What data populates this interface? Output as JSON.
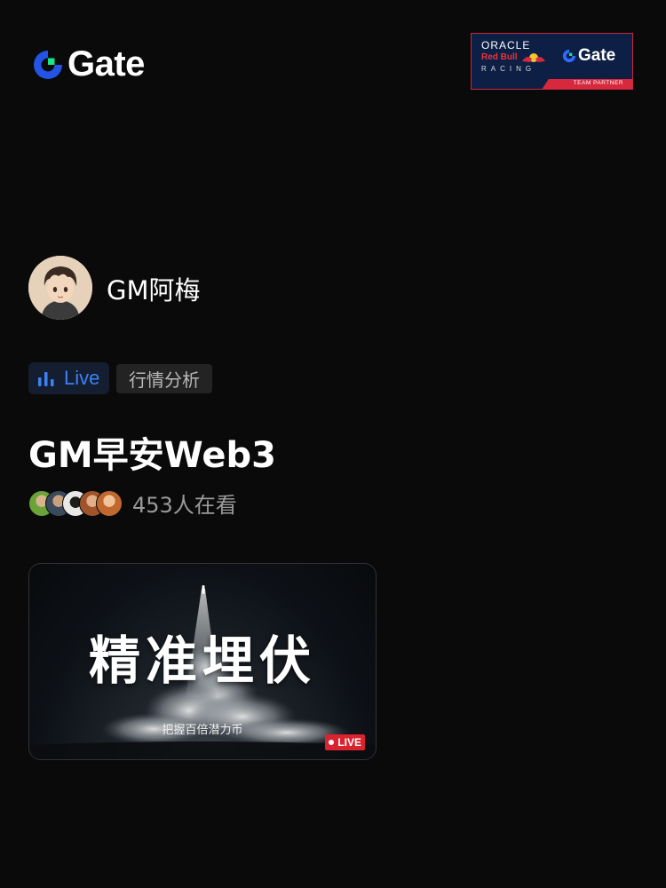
{
  "brand": {
    "name": "Gate",
    "accent": "#2354e6",
    "accent_green": "#17e58a"
  },
  "partner_banner": {
    "line1": "ORACLE",
    "line2": "Red Bull",
    "line3": "RACING",
    "brand": "Gate",
    "footer": "TEAM PARTNER",
    "bg_color": "#0e1f45",
    "accent_color": "#d8283e"
  },
  "host": {
    "name": "GM阿梅",
    "avatar_icon": "anime-avatar-icon"
  },
  "tags": {
    "live_label": "Live",
    "category": "行情分析",
    "live_color": "#3b82f6"
  },
  "stream": {
    "title": "GM早安Web3"
  },
  "viewers": {
    "count_text": "453人在看"
  },
  "cover": {
    "headline": "精准埋伏",
    "subtitle": "把握百倍潜力币",
    "badge": "LIVE",
    "badge_color": "#d9232f"
  }
}
